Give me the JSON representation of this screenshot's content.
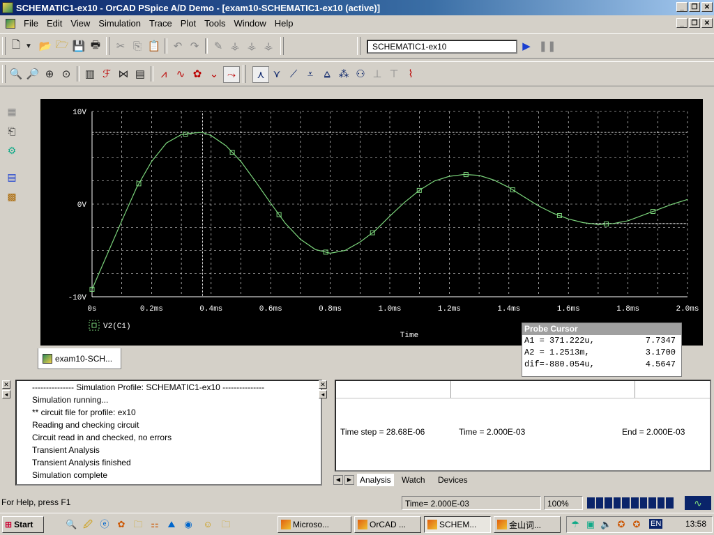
{
  "window": {
    "title": "SCHEMATIC1-ex10 - OrCAD PSpice A/D Demo  - [exam10-SCHEMATIC1-ex10 (active)]"
  },
  "menu": [
    "File",
    "Edit",
    "View",
    "Simulation",
    "Trace",
    "Plot",
    "Tools",
    "Window",
    "Help"
  ],
  "toolbar": {
    "profile": "SCHEMATIC1-ex10"
  },
  "plot": {
    "trace_label": "V2(C1)",
    "x_axis_title": "Time",
    "x_ticks": [
      "0s",
      "0.2ms",
      "0.4ms",
      "0.6ms",
      "0.8ms",
      "1.0ms",
      "1.2ms",
      "1.4ms",
      "1.6ms",
      "1.8ms",
      "2.0ms"
    ],
    "y_ticks": [
      "10V",
      "0V",
      "-10V"
    ],
    "trace_color": "#7cd67c",
    "background": "#000000"
  },
  "chart_data": {
    "type": "line",
    "xlabel": "Time",
    "ylabel": "",
    "xlim": [
      0,
      2.0
    ],
    "ylim": [
      -10,
      10
    ],
    "x_unit": "ms",
    "series": [
      {
        "name": "V2(C1)",
        "x": [
          0,
          0.05,
          0.1,
          0.15,
          0.2,
          0.25,
          0.3,
          0.35,
          0.371,
          0.4,
          0.45,
          0.5,
          0.55,
          0.6,
          0.65,
          0.7,
          0.75,
          0.8,
          0.85,
          0.9,
          0.95,
          1.0,
          1.05,
          1.1,
          1.15,
          1.2,
          1.25,
          1.3,
          1.35,
          1.4,
          1.45,
          1.5,
          1.55,
          1.6,
          1.65,
          1.7,
          1.75,
          1.8,
          1.85,
          1.9,
          1.95,
          2.0
        ],
        "values": [
          -9.2,
          -5.5,
          -1.8,
          1.8,
          4.6,
          6.6,
          7.5,
          7.7,
          7.73,
          7.4,
          6.3,
          4.6,
          2.4,
          0.1,
          -2.1,
          -3.8,
          -4.9,
          -5.3,
          -5.0,
          -4.1,
          -2.9,
          -1.3,
          0.2,
          1.5,
          2.5,
          3.0,
          3.2,
          3.1,
          2.6,
          1.8,
          0.8,
          -0.2,
          -1.0,
          -1.6,
          -2.0,
          -2.2,
          -2.1,
          -1.8,
          -1.2,
          -0.6,
          0.0,
          0.5
        ]
      }
    ],
    "markers_x": [
      0,
      0.157,
      0.314,
      0.471,
      0.628,
      0.785,
      0.942,
      1.099,
      1.256,
      1.413,
      1.57,
      1.727,
      1.884
    ],
    "cursor": {
      "a1_x": 0.371222,
      "a1_y": 7.7347,
      "a2_x": 1.2513,
      "a2_y": 3.17
    }
  },
  "probe_cursor": {
    "title": "Probe Cursor",
    "rows": [
      {
        "label": "A1 = 371.222u,",
        "value": "7.7347"
      },
      {
        "label": "A2 =  1.2513m,",
        "value": "3.1700"
      },
      {
        "label": "dif=-880.054u,",
        "value": "4.5647"
      }
    ]
  },
  "doc_tab": "exam10-SCH...",
  "output": {
    "lines": [
      "--------------- Simulation Profile:  SCHEMATIC1-ex10 ---------------",
      "Simulation running...",
      "** circuit file for profile: ex10",
      "Reading and checking circuit",
      "Circuit read in and checked, no errors",
      "Transient Analysis",
      "Transient Analysis finished",
      "Simulation complete"
    ]
  },
  "analysis": {
    "time_step": "Time step = 28.68E-06",
    "time": "Time = 2.000E-03",
    "end": "End = 2.000E-03",
    "tabs": [
      "Analysis",
      "Watch",
      "Devices"
    ]
  },
  "status": {
    "help": "For Help, press F1",
    "time": "Time= 2.000E-03",
    "zoom": "100%",
    "progress": 1.0
  },
  "taskbar": {
    "start": "Start",
    "tasks": [
      "Microso...",
      "OrCAD ...",
      "SCHEM...",
      "金山词..."
    ],
    "lang": "EN",
    "clock": "13:58"
  }
}
